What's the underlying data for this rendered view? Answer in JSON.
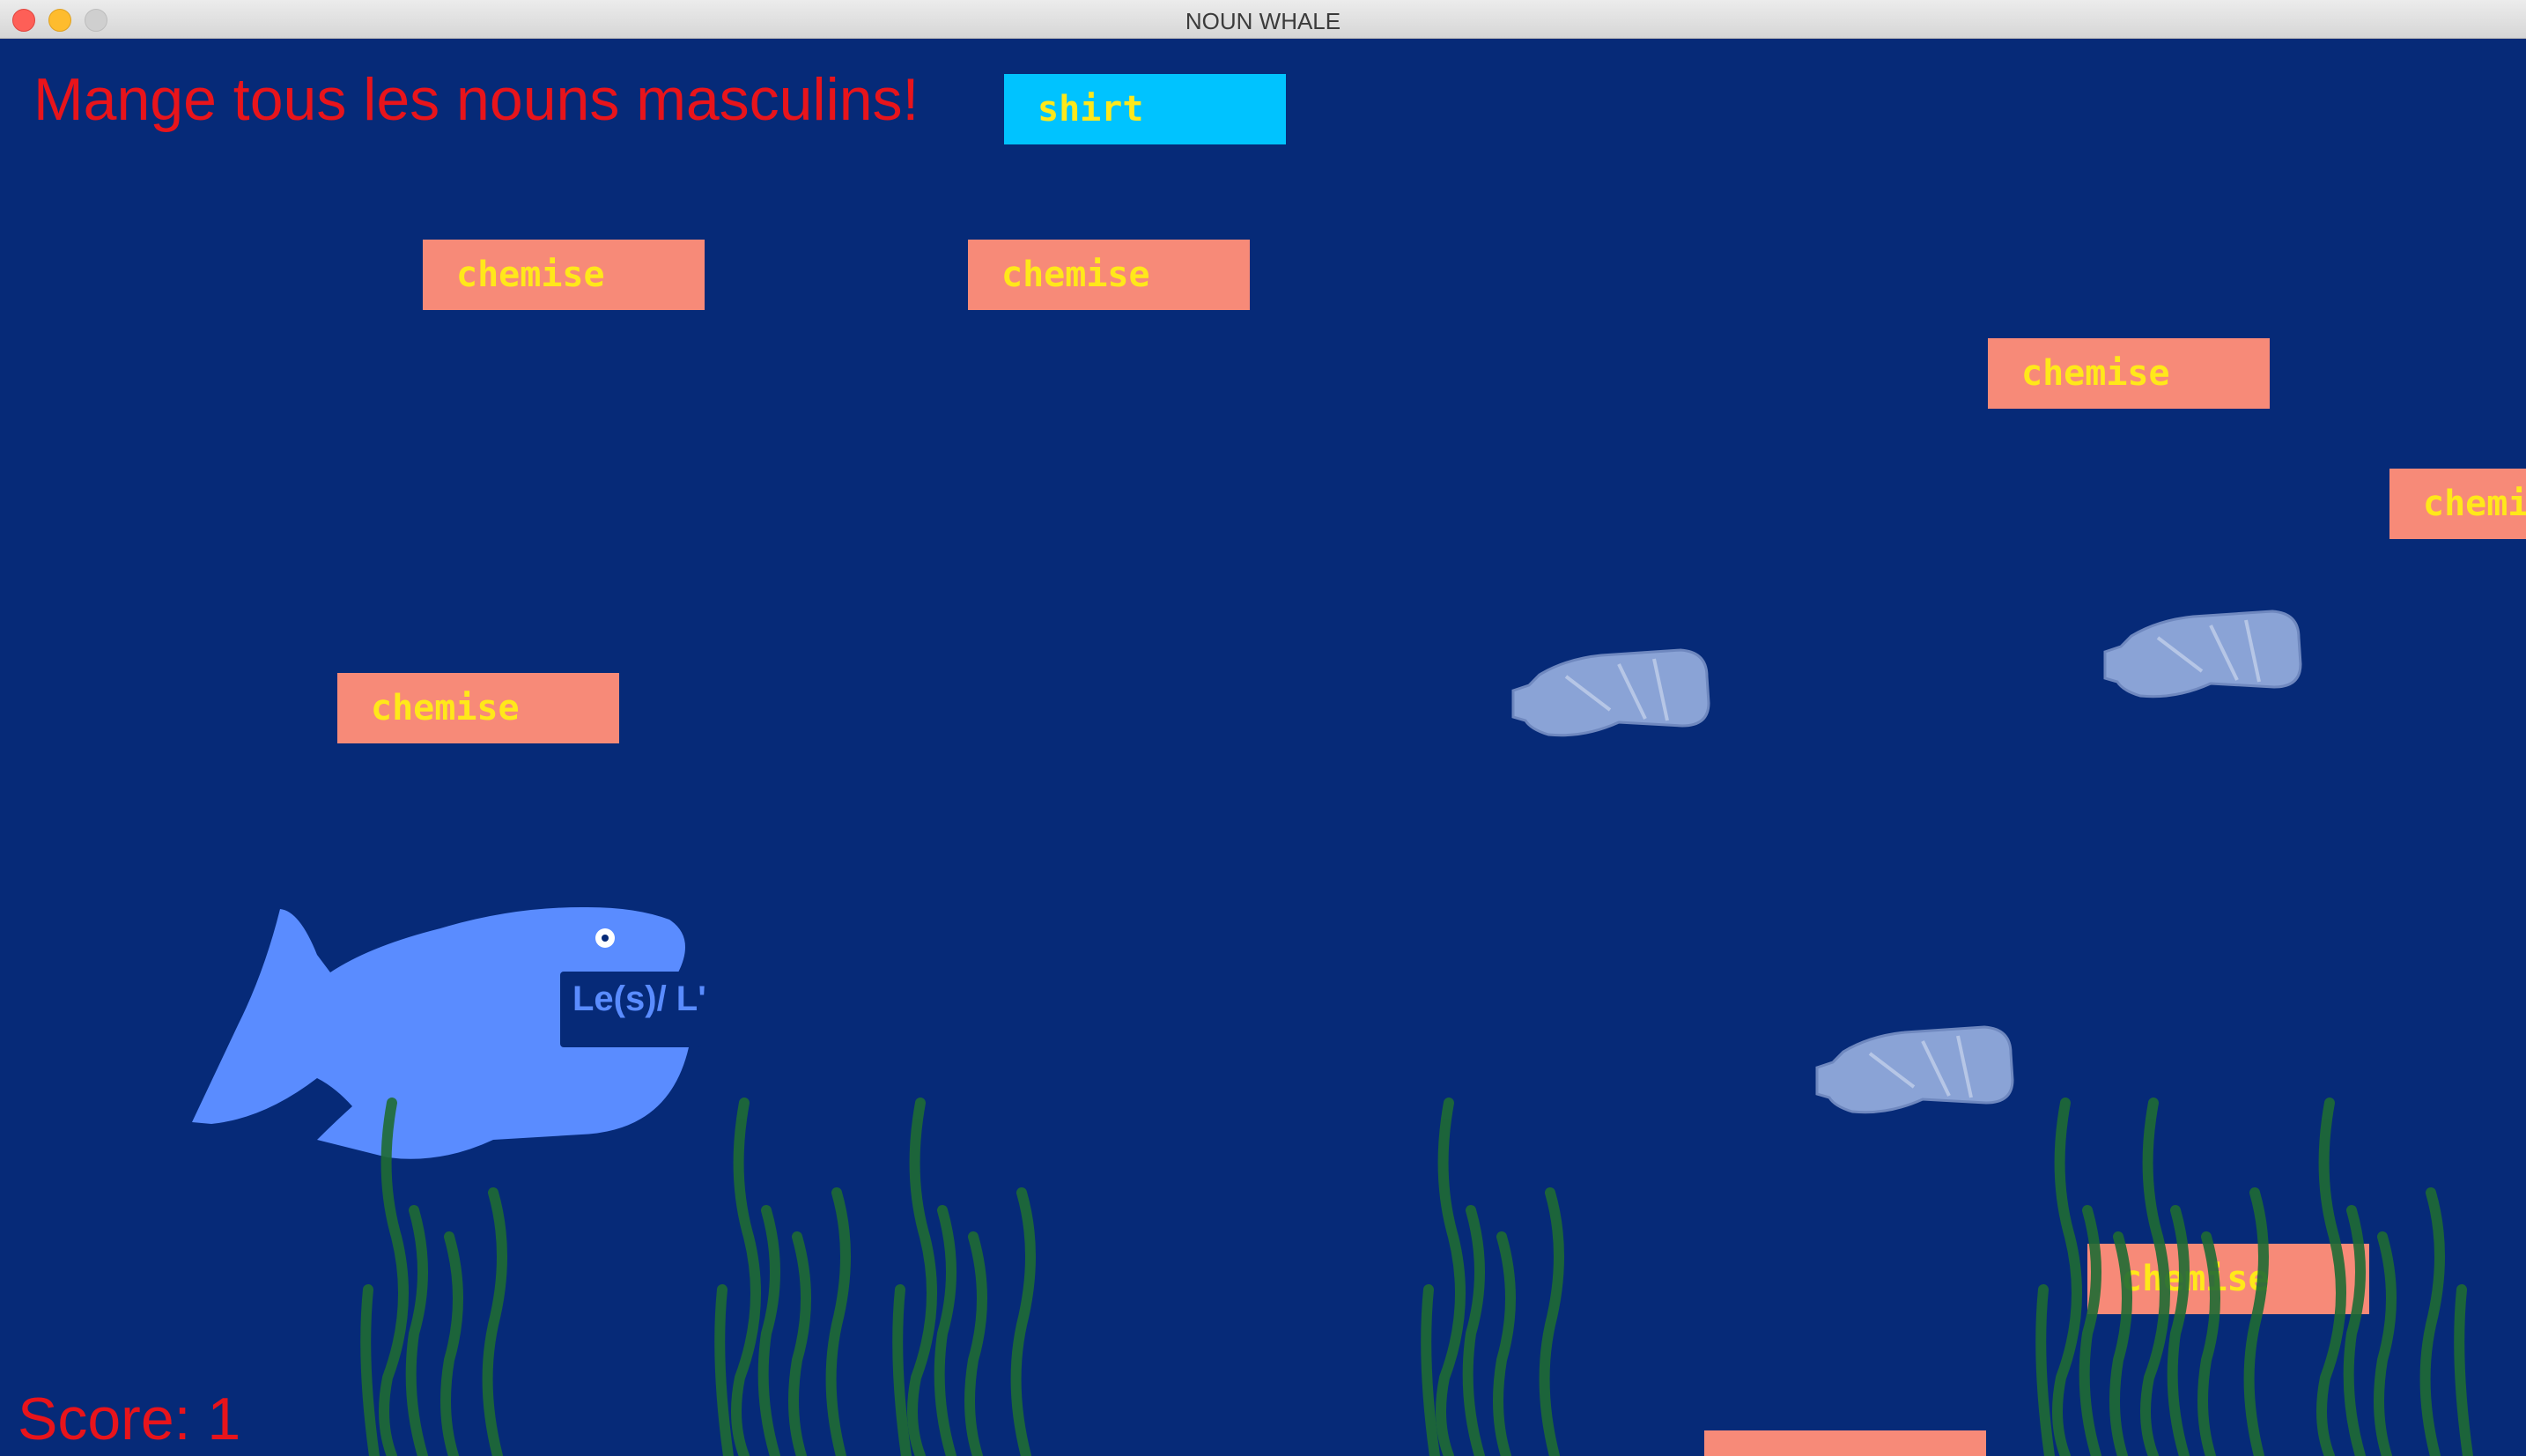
{
  "window": {
    "title": "NOUN WHALE"
  },
  "game": {
    "instruction": "Mange tous les nouns masculins!",
    "score": "Score: 1",
    "target_word": "shirt",
    "words": [
      {
        "text": "chemise"
      },
      {
        "text": "chemise"
      },
      {
        "text": "chemise"
      },
      {
        "text": "chemi"
      },
      {
        "text": "chemise"
      },
      {
        "text": "chemise"
      },
      {
        "text": ""
      }
    ],
    "whale": {
      "mouth_label": "Le(s)/ L'"
    },
    "obstacles": [
      "plastic-bottle",
      "plastic-bottle",
      "plastic-bottle"
    ],
    "colors": {
      "ocean": "#062a78",
      "text_red": "#e8141b",
      "card_salmon": "#f78a78",
      "card_target": "#00c3ff",
      "card_text": "#ffe81a",
      "whale": "#5a8cff",
      "seaweed": "#1f6b34",
      "bottle": "#8aa3d6"
    }
  }
}
